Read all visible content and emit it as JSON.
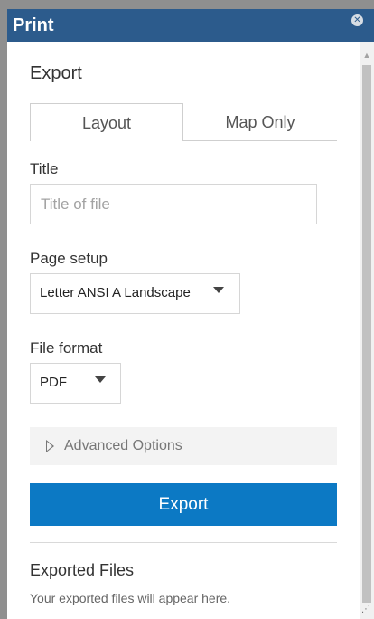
{
  "window": {
    "title": "Print",
    "close_icon": "close-icon"
  },
  "export": {
    "heading": "Export",
    "tabs": [
      {
        "label": "Layout",
        "active": true
      },
      {
        "label": "Map Only",
        "active": false
      }
    ],
    "title_field": {
      "label": "Title",
      "value": "",
      "placeholder": "Title of file"
    },
    "page_setup": {
      "label": "Page setup",
      "selected": "Letter ANSI A Landscape"
    },
    "file_format": {
      "label": "File format",
      "selected": "PDF"
    },
    "advanced_options_label": "Advanced Options",
    "export_button_label": "Export"
  },
  "exported_files": {
    "heading": "Exported Files",
    "note": "Your exported files will appear here."
  },
  "colors": {
    "titlebar": "#2c5b8c",
    "export_button": "#0c79c4"
  }
}
